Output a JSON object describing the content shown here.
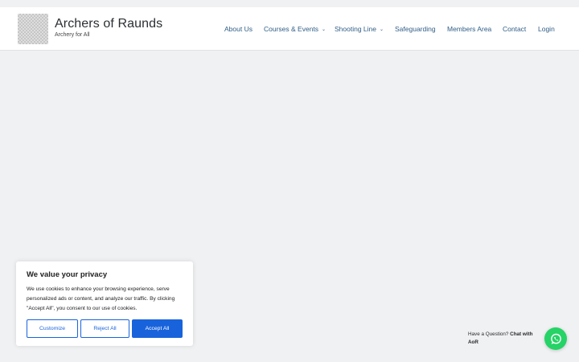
{
  "site": {
    "title": "Archers of Raunds",
    "tagline": "Archery for All"
  },
  "nav": {
    "items": [
      {
        "label": "About Us",
        "has_dropdown": false
      },
      {
        "label": "Courses & Events",
        "has_dropdown": true
      },
      {
        "label": "Shooting Line",
        "has_dropdown": true
      },
      {
        "label": "Safeguarding",
        "has_dropdown": false
      },
      {
        "label": "Members Area",
        "has_dropdown": false
      },
      {
        "label": "Contact",
        "has_dropdown": false
      },
      {
        "label": "Login",
        "has_dropdown": false
      }
    ]
  },
  "cookie_banner": {
    "title": "We value your privacy",
    "text": "We use cookies to enhance your browsing experience, serve personalized ads or content, and analyze our traffic. By clicking \"Accept All\", you consent to our use of cookies.",
    "customize_label": "Customize",
    "reject_label": "Reject All",
    "accept_label": "Accept All"
  },
  "chat": {
    "prompt": "Have a Question?",
    "action": "Chat with AoR",
    "icon": "whatsapp-icon"
  },
  "colors": {
    "accent": "#1863dc",
    "nav_link": "#2f5d86",
    "whatsapp": "#25d366",
    "page_background": "#f0f1f3"
  }
}
